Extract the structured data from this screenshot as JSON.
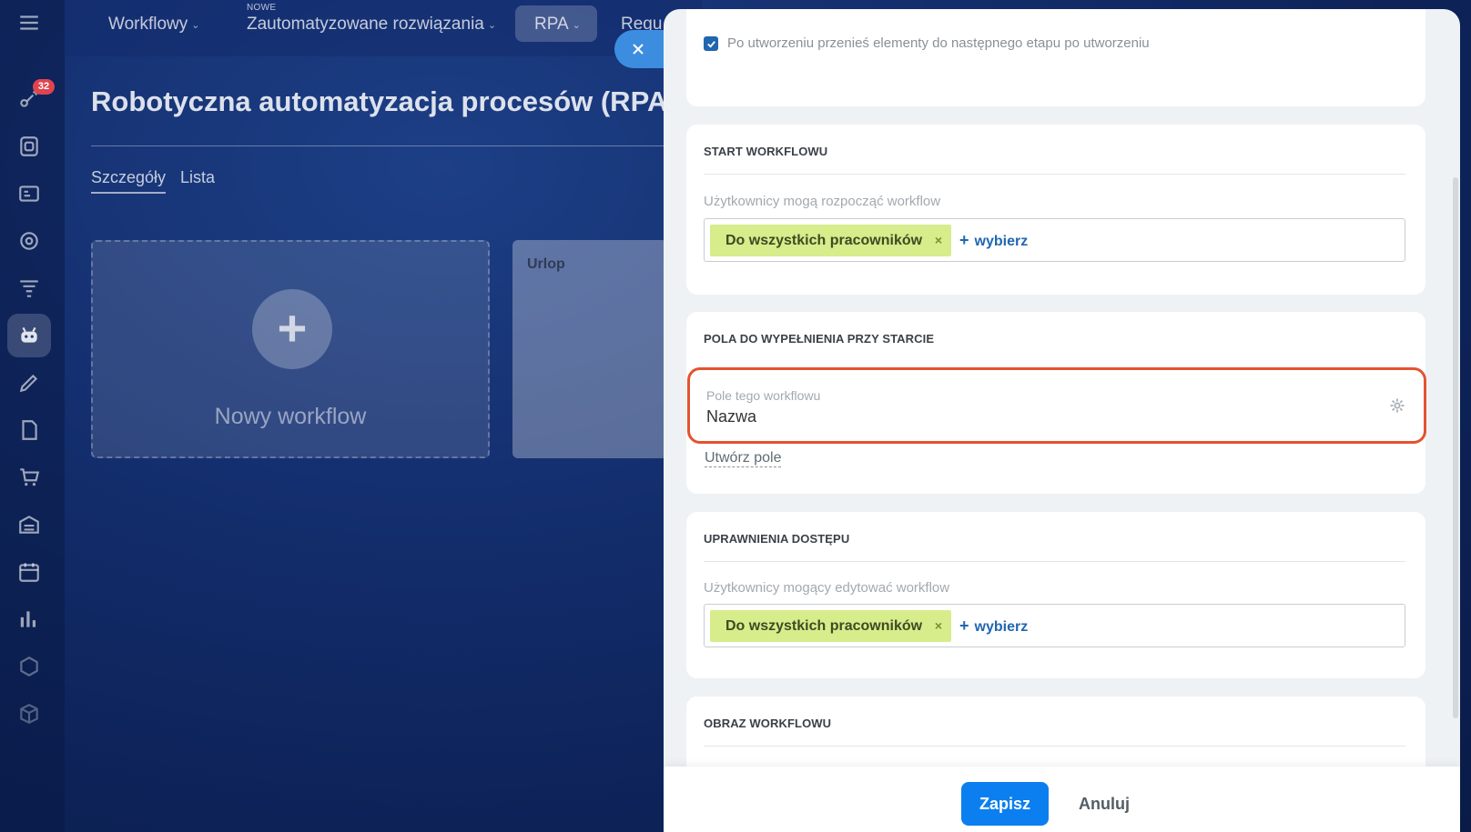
{
  "topnav": {
    "items": [
      {
        "label": "Workflowy"
      },
      {
        "label": "Zautomatyzowane rozwiązania",
        "tag": "NOWE"
      },
      {
        "label": "RPA"
      },
      {
        "label": "Regu"
      }
    ]
  },
  "rail": {
    "badge_count": "32",
    "icons": [
      "menu-icon",
      "chat-icon",
      "tasks-icon",
      "crm-icon",
      "target-icon",
      "funnel-icon",
      "rpa-robot-icon",
      "sign-icon",
      "doc-icon",
      "shop-icon",
      "warehouse-icon",
      "calendar-icon",
      "analytics-icon",
      "hexagon-icon",
      "box-icon"
    ]
  },
  "page": {
    "title": "Robotyczna automatyzacja procesów (RPA)",
    "tabs": [
      "Szczegóły",
      "Lista"
    ],
    "new_card_label": "Nowy workflow",
    "card_urlop": "Urlop"
  },
  "panel": {
    "move_checkbox": {
      "checked": true,
      "label": "Po utworzeniu przenieś elementy do następnego etapu po utworzeniu"
    },
    "start_section": {
      "title": "START WORKFLOWU",
      "field_label": "Użytkownicy mogą rozpocząć workflow",
      "tag": "Do wszystkich pracowników",
      "add_label": "wybierz"
    },
    "fields_section": {
      "title": "POLA DO WYPEŁNIENIA PRZY STARCIE",
      "field_label": "Pole tego workflowu",
      "field_value": "Nazwa",
      "create_link": "Utwórz pole"
    },
    "access_section": {
      "title": "UPRAWNIENIA DOSTĘPU",
      "field_label": "Użytkownicy mogący edytować workflow",
      "tag": "Do wszystkich pracowników",
      "add_label": "wybierz"
    },
    "image_section": {
      "title": "OBRAZ WORKFLOWU"
    },
    "footer": {
      "save_label": "Zapisz",
      "cancel_label": "Anuluj"
    }
  },
  "colors": {
    "accent": "#0b7ff0",
    "tag_bg": "#d7ec8b",
    "highlight": "#e3532f"
  }
}
